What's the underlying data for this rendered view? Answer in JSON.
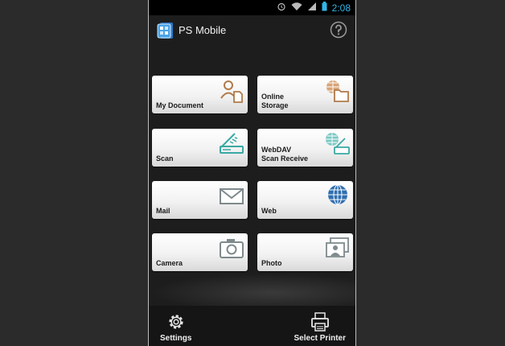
{
  "status_bar": {
    "time": "2:08"
  },
  "app": {
    "title": "PS Mobile"
  },
  "tiles": [
    {
      "label": "My Document",
      "icon": "document-person-icon"
    },
    {
      "label": "Online\nStorage",
      "icon": "globe-folder-icon"
    },
    {
      "label": "Scan",
      "icon": "scanner-icon"
    },
    {
      "label": "WebDAV\nScan Receive",
      "icon": "globe-scanner-icon"
    },
    {
      "label": "Mail",
      "icon": "mail-icon"
    },
    {
      "label": "Web",
      "icon": "globe-icon"
    },
    {
      "label": "Camera",
      "icon": "camera-icon"
    },
    {
      "label": "Photo",
      "icon": "photo-icon"
    }
  ],
  "bottom_bar": {
    "settings_label": "Settings",
    "printer_label": "Select Printer"
  },
  "colors": {
    "accent": "#33b5e5",
    "icon_brown": "#b07a4a",
    "icon_teal": "#3aa9a4",
    "icon_grey": "#7f8a8c",
    "icon_blue": "#2f6fb0"
  }
}
